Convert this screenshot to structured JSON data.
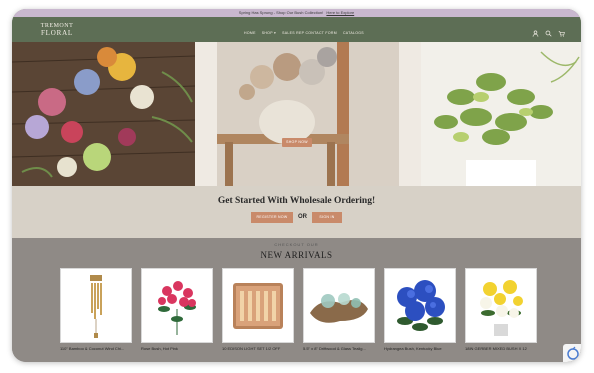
{
  "announcement": {
    "text": "Spring Has Sprung - Shop Our Bush Collection!",
    "link": "Here to Explore"
  },
  "logo": {
    "line1": "TREMONT",
    "line2": "FLORAL",
    "line3": "SINCE 1980"
  },
  "nav": [
    "HOME",
    "SHOP ▾",
    "SALES REP CONTACT FORM",
    "CATALOGS"
  ],
  "icons": [
    "user-icon",
    "search-icon",
    "cart-icon"
  ],
  "hero": {
    "button": "SHOP NOW"
  },
  "cta": {
    "title": "Get Started With Wholesale Ordering!",
    "register": "REGISTER NOW",
    "or": "OR",
    "signin": "SIGN IN"
  },
  "arrivals": {
    "kicker": "CHECKOUT OUR",
    "title": "NEW ARRIVALS"
  },
  "products": [
    {
      "name": "110\" Bamboo & Coconut Wind Chi..."
    },
    {
      "name": "Rose Bush, Hot Pink"
    },
    {
      "name": "10 EDISON LIGHT SET 1/2 OFF"
    },
    {
      "name": "5.5\" x 8\" Driftwood & Glass Tealig..."
    },
    {
      "name": "Hydrangea Bush, Kentucky Blue"
    },
    {
      "name": "18IN GERBER MIXED BUSH X 12"
    }
  ],
  "colors": {
    "header": "#5d6e55",
    "announce": "#c9b8cf",
    "accent": "#c98a6a",
    "cta_bg": "#d7d1c7",
    "arrivals_bg": "#8f8a86"
  }
}
